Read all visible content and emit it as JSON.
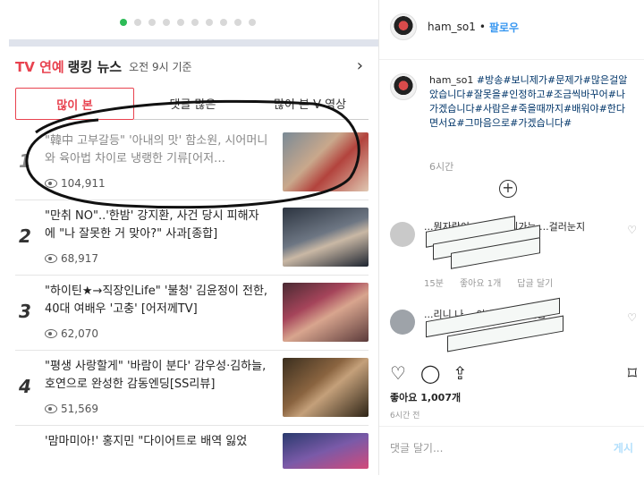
{
  "left": {
    "header": {
      "title_red": "TV 연예",
      "title": "랭킹 뉴스",
      "time": "오전 9시 기준",
      "more_icon": "chevron-right-icon"
    },
    "tabs": [
      {
        "label": "많이 본"
      },
      {
        "label": "댓글 많은"
      },
      {
        "label": "많이 본 V 영상"
      }
    ],
    "news": [
      {
        "rank": "1",
        "title": "\"韓中 고부갈등\" '아내의 맛' 함소원, 시어머니와 육아법 차이로 냉랭한 기류[어저…",
        "views": "104,911"
      },
      {
        "rank": "2",
        "title": "\"만취 NO\"..'한밤' 강지환, 사건 당시 피해자에 \"나 잘못한 거 맞아?\" 사과[종합]",
        "views": "68,917"
      },
      {
        "rank": "3",
        "title": "\"하이틴★→직장인Life\" '불청' 김윤정이 전한, 40대 여배우 '고충' [어저께TV]",
        "views": "62,070"
      },
      {
        "rank": "4",
        "title": "\"평생 사랑할게\" '바람이 분다' 감우성·김하늘, 호연으로 완성한 감동엔딩[SS리뷰]",
        "views": "51,569"
      },
      {
        "rank": "5",
        "title": "'맘마미아!' 홍지민 \"다이어트로 배역 잃었",
        "views": ""
      }
    ]
  },
  "right": {
    "username": "ham_so1",
    "separator": "•",
    "follow": "팔로우",
    "caption_user": "ham_so1",
    "caption": " #방송#보니제가#문제가#많은걸알았습니다#잘못을#인정하고#조금씩바꾸어#나가겠습니다#사람은#죽을때까지#배워야#한다면서요#그마음으로#가겠습니다#",
    "caption_time": "6시간",
    "comments": [
      {
        "text": "...뭔자랑이 ...머니다되가는 ...걸러눈지",
        "time": "15분",
        "likes": "좋아요 1개",
        "reply": "답글 달기"
      },
      {
        "text": "...리니 나 ...이네 ㅎ ...큰일남",
        "time": "",
        "likes": "",
        "reply": ""
      }
    ],
    "likes": "좋아요 1,007개",
    "post_time": "6시간 전",
    "comment_placeholder": "댓글 달기...",
    "post_button": "게시"
  }
}
